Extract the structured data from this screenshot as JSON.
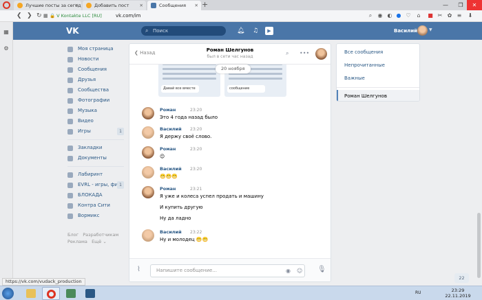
{
  "browser": {
    "tabs": [
      {
        "title": "Лучшие посты за сегодн",
        "active": false
      },
      {
        "title": "Добавить пост",
        "active": false
      },
      {
        "title": "Сообщения",
        "active": true
      }
    ],
    "site_badge": "V Kontakte LLC [RU]",
    "url": "vk.com/im",
    "status_url": "https://vk.com/vudack_production"
  },
  "vk": {
    "search_placeholder": "Поиск",
    "user_name": "Василий",
    "menu": [
      {
        "label": "Моя страница",
        "count": ""
      },
      {
        "label": "Новости",
        "count": ""
      },
      {
        "label": "Сообщения",
        "count": ""
      },
      {
        "label": "Друзья",
        "count": ""
      },
      {
        "label": "Сообщества",
        "count": ""
      },
      {
        "label": "Фотографии",
        "count": ""
      },
      {
        "label": "Музыка",
        "count": ""
      },
      {
        "label": "Видео",
        "count": ""
      },
      {
        "label": "Игры",
        "count": "1"
      },
      {
        "label": "Закладки",
        "count": ""
      },
      {
        "label": "Документы",
        "count": ""
      },
      {
        "label": "Лабиринт",
        "count": ""
      },
      {
        "label": "EVRL - игры, фи...",
        "count": "1"
      },
      {
        "label": "БЛОКАДА",
        "count": ""
      },
      {
        "label": "Контра Сити",
        "count": ""
      },
      {
        "label": "Вормикс",
        "count": ""
      }
    ],
    "footer": {
      "l1": "Блог",
      "l2": "Разработчикам",
      "l3": "Реклама",
      "l4": "Ещё ⌄"
    }
  },
  "chat": {
    "back_label": "Назад",
    "peer_name": "Роман Шелгунов",
    "peer_status": "был в сети час назад",
    "date_pill": "20 ноября",
    "scrap_left": "Давай все вместе",
    "scrap_right": "сообщение",
    "messages": [
      {
        "author": "Роман",
        "time": "23:20",
        "lines": [
          "Это 4 года назад было"
        ]
      },
      {
        "author": "Василий",
        "time": "23:20",
        "lines": [
          "Я держу своё слово."
        ]
      },
      {
        "author": "Роман",
        "time": "23:20",
        "lines": [
          "😉"
        ]
      },
      {
        "author": "Василий",
        "time": "23:20",
        "lines": [
          "😬😬😬"
        ]
      },
      {
        "author": "Роман",
        "time": "23:21",
        "lines": [
          "Я уже и колеса успел продать и машину",
          "И купить другую",
          "Ну да ладно"
        ]
      },
      {
        "author": "Василий",
        "time": "23:22",
        "lines": [
          "Ну и молодец 😬😬"
        ]
      }
    ],
    "composer_placeholder": "Напишите сообщение..."
  },
  "right_panel": {
    "items": [
      "Все сообщения",
      "Непрочитанные",
      "Важные"
    ],
    "selected": "Роман Шелгунов"
  },
  "unread_badge": "22",
  "taskbar": {
    "lang": "RU",
    "time": "23:29",
    "date": "22.11.2019"
  }
}
